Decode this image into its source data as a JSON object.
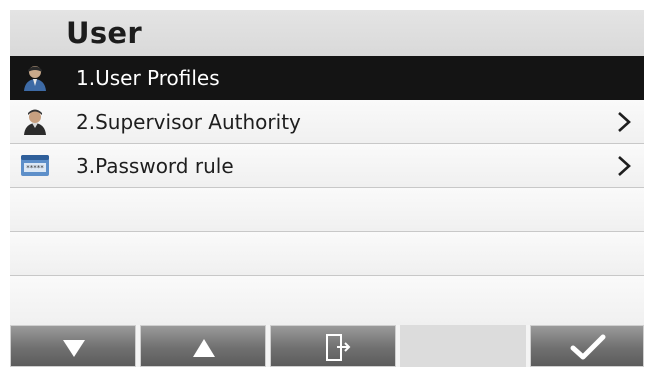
{
  "header": {
    "title": "User"
  },
  "menu": {
    "items": [
      {
        "label": "1.User Profiles",
        "icon": "user-profile-icon",
        "selected": true,
        "has_submenu": false
      },
      {
        "label": "2.Supervisor Authority",
        "icon": "supervisor-icon",
        "selected": false,
        "has_submenu": true
      },
      {
        "label": "3.Password rule",
        "icon": "password-card-icon",
        "selected": false,
        "has_submenu": true
      }
    ]
  },
  "softkeys": [
    {
      "icon": "arrow-down-icon"
    },
    {
      "icon": "arrow-up-icon"
    },
    {
      "icon": "exit-door-icon"
    },
    {
      "icon": ""
    },
    {
      "icon": "checkmark-icon"
    }
  ],
  "colors": {
    "selected_row": "#141414",
    "softkey": "#707070"
  }
}
